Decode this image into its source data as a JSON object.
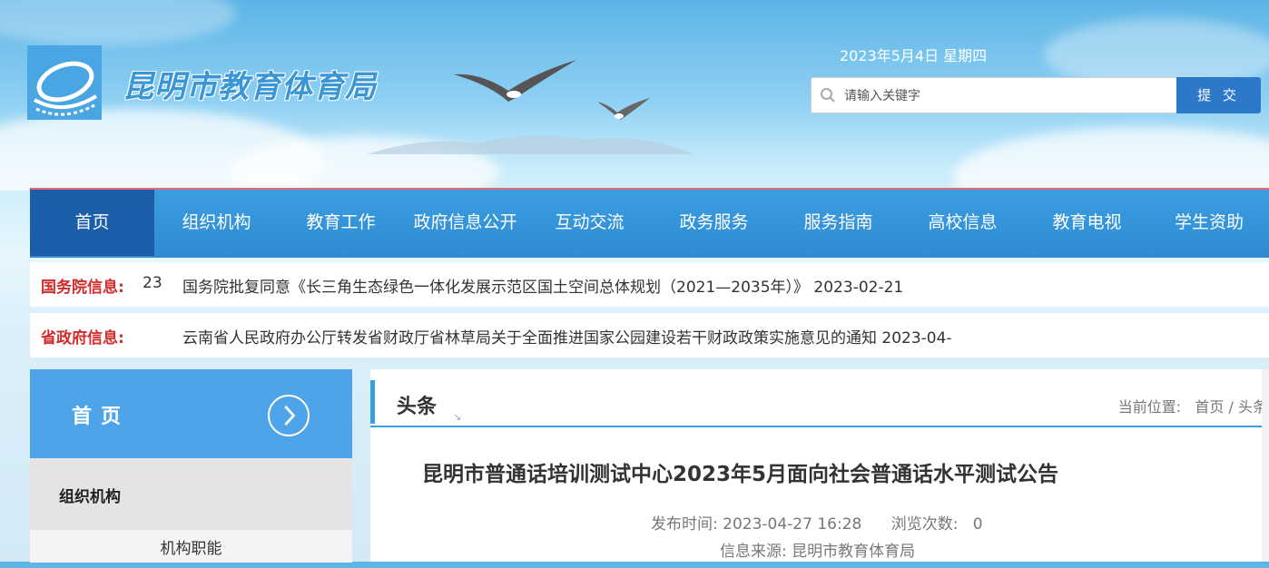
{
  "header": {
    "site_title": "昆明市教育体育局",
    "date": "2023年5月4日 星期四",
    "search": {
      "placeholder": "请输入关键字",
      "submit_label": "提 交"
    }
  },
  "nav": {
    "items": [
      {
        "label": "首页",
        "active": true
      },
      {
        "label": "组织机构"
      },
      {
        "label": "教育工作"
      },
      {
        "label": "政府信息公开"
      },
      {
        "label": "互动交流"
      },
      {
        "label": "政务服务"
      },
      {
        "label": "服务指南"
      },
      {
        "label": "高校信息"
      },
      {
        "label": "教育电视"
      },
      {
        "label": "学生资助"
      }
    ]
  },
  "notices": [
    {
      "label": "国务院信息:",
      "prefix": "23",
      "text": "国务院批复同意《长三角生态绿色一体化发展示范区国土空间总体规划（2021—2035年）》 2023-02-21"
    },
    {
      "label": "省政府信息:",
      "prefix": "",
      "text": "云南省人民政府办公厅转发省财政厅省林草局关于全面推进国家公园建设若干财政政策实施意见的通知 2023-04-"
    }
  ],
  "sidebar": {
    "home_label": "首页",
    "section_label": "组织机构",
    "sub_item_label": "机构职能"
  },
  "content": {
    "section_title": "头条",
    "breadcrumb": {
      "prefix": "当前位置:",
      "home": "首页",
      "sep": "/",
      "current": "头条"
    },
    "article_title": "昆明市普通话培训测试中心2023年5月面向社会普通话水平测试公告",
    "publish_label": "发布时间:",
    "publish_time": "2023-04-27 16:28",
    "views_label": "浏览次数:",
    "views": "0",
    "source_label": "信息来源:",
    "source": "昆明市教育体育局"
  },
  "colors": {
    "nav_bg": "#2f8ad3",
    "nav_active": "#1b5faa",
    "accent": "#3b9ee0",
    "notice_label": "#d12b2b"
  }
}
